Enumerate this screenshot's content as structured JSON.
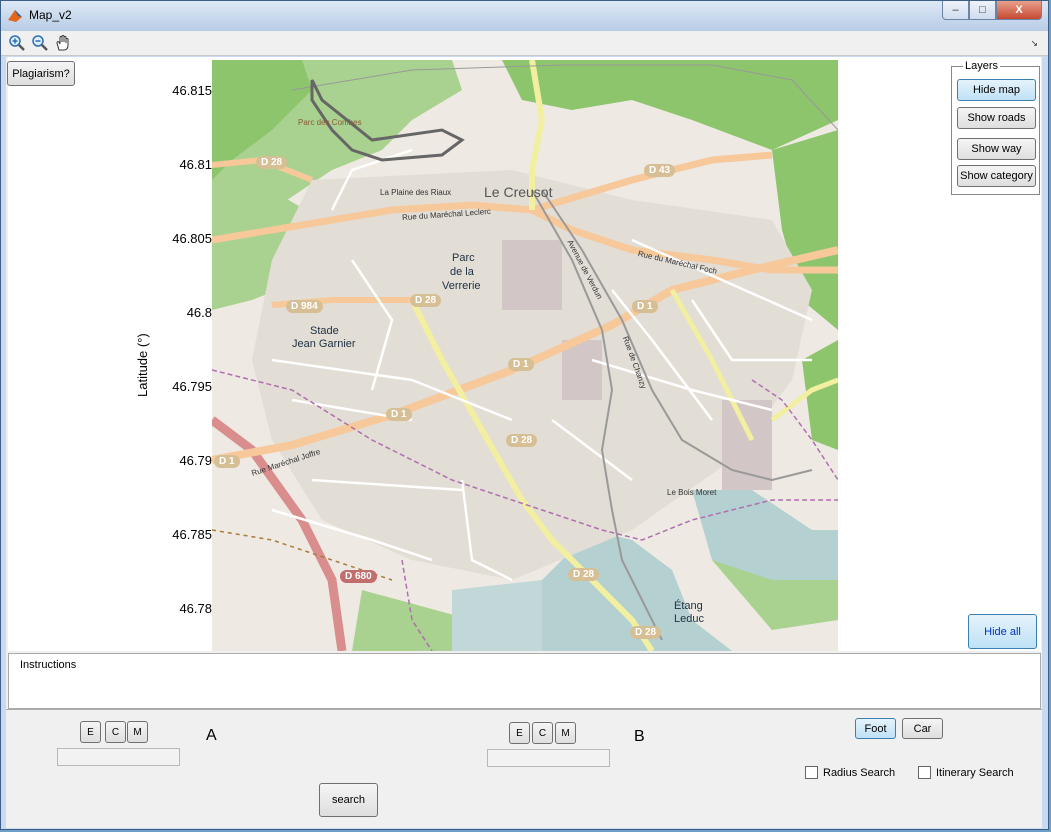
{
  "window": {
    "title": "Map_v2"
  },
  "titlebar": {
    "minimize": "–",
    "maximize": "□",
    "close": "X"
  },
  "toolbar": {
    "zoom_in_icon": "zoom-in",
    "zoom_out_icon": "zoom-out",
    "pan_icon": "pan-hand",
    "arrow": "↘"
  },
  "buttons": {
    "plagiarism": "Plagiarism?",
    "hide_all": "Hide all",
    "search": "search",
    "foot": "Foot",
    "car": "Car"
  },
  "layers": {
    "title": "Layers",
    "hide_map": "Hide map",
    "show_roads": "Show roads",
    "show_way": "Show way",
    "show_category": "Show category"
  },
  "axis": {
    "ylabel": "Latitude (°)",
    "ticks": [
      "46.815",
      "46.81",
      "46.805",
      "46.8",
      "46.795",
      "46.79",
      "46.785",
      "46.78"
    ]
  },
  "map": {
    "labels": {
      "le_creusot": "Le Creusot",
      "parc_verrerie_1": "Parc",
      "parc_verrerie_2": "de la",
      "parc_verrerie_3": "Verrerie",
      "stade_1": "Stade",
      "stade_2": "Jean Garnier",
      "etang_1": "Étang",
      "etang_2": "Leduc",
      "le_bois_moret": "Le Bois Moret",
      "la_plaine": "La Plaine des Riaux",
      "parc_combes": "Parc des Combes",
      "rue_leclerc": "Rue du Maréchal Leclerc",
      "rue_foch": "Rue du Maréchal Foch",
      "rue_joffre": "Rue Maréchal Joffre",
      "av_verdun": "Avenue de Verdun",
      "rue_chanzy": "Rue de Chanzy"
    },
    "shields": {
      "d28_a": "D 28",
      "d43": "D 43",
      "d984": "D 984",
      "d28_b": "D 28",
      "d1_a": "D 1",
      "d1_b": "D 1",
      "d1_c": "D 1",
      "d28_c": "D 28",
      "d1_d": "D 1",
      "d680": "D 680",
      "d28_d": "D 28",
      "d28_e": "D 28"
    }
  },
  "instructions": {
    "label": "Instructions",
    "text": ""
  },
  "point_a": {
    "letter": "A",
    "e": "E",
    "c": "C",
    "m": "M",
    "value": ""
  },
  "point_b": {
    "letter": "B",
    "e": "E",
    "c": "C",
    "m": "M",
    "value": ""
  },
  "options": {
    "radius_search": "Radius Search",
    "itinerary_search": "Itinerary Search"
  },
  "colors": {
    "map_bg": "#eeeae3",
    "forest": "#8dc56c",
    "primary_road": "#f7c89a",
    "secondary_road": "#f3efa0",
    "water": "#b4d0d1",
    "rail": "#999999"
  }
}
